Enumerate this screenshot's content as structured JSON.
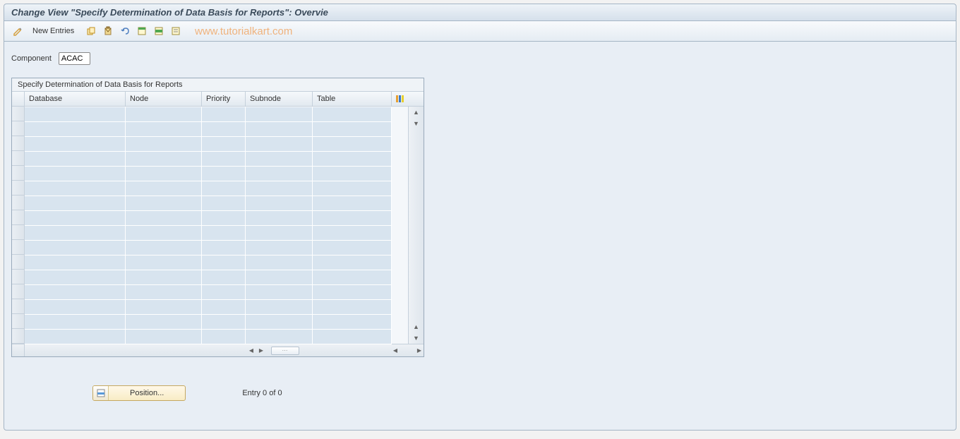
{
  "title": "Change View \"Specify Determination of Data Basis for Reports\": Overvie",
  "toolbar": {
    "new_entries_label": "New Entries"
  },
  "watermark": "www.tutorialkart.com",
  "component": {
    "label": "Component",
    "value": "ACAC"
  },
  "table": {
    "title": "Specify Determination of Data Basis for Reports",
    "columns": {
      "database": "Database",
      "node": "Node",
      "priority": "Priority",
      "subnode": "Subnode",
      "table": "Table"
    },
    "rows": []
  },
  "footer": {
    "position_label": "Position...",
    "entry_text": "Entry 0 of 0"
  }
}
